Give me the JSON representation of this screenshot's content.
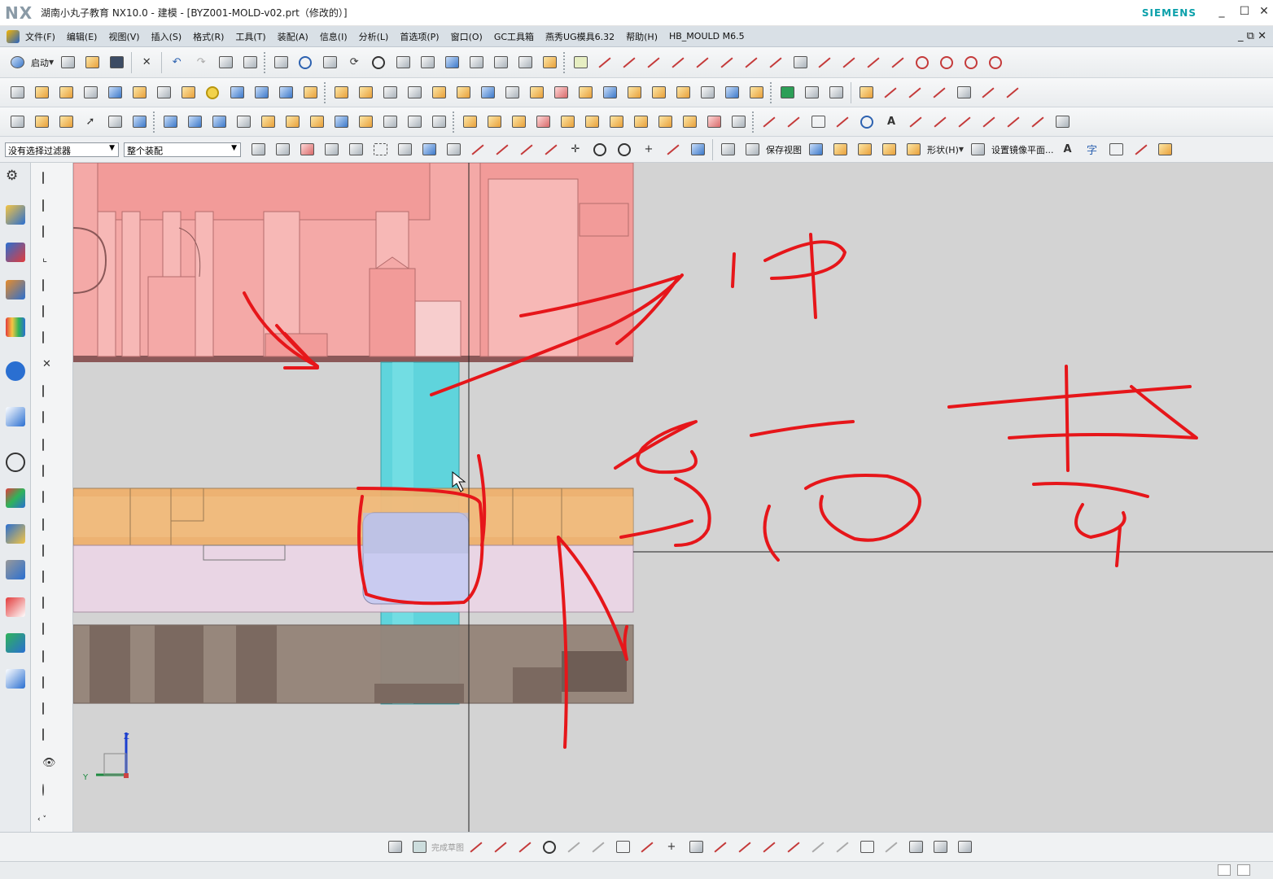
{
  "titlebar": {
    "logo": "NX",
    "title": "湖南小丸子教育 NX10.0 - 建模 - [BYZ001-MOLD-v02.prt（修改的）]",
    "brand": "SIEMENS",
    "minimize": "_",
    "maximize": "☐",
    "close": "✕"
  },
  "menubar": {
    "items": [
      "文件(F)",
      "编辑(E)",
      "视图(V)",
      "插入(S)",
      "格式(R)",
      "工具(T)",
      "装配(A)",
      "信息(I)",
      "分析(L)",
      "首选项(P)",
      "窗口(O)",
      "GC工具箱",
      "燕秀UG模具6.32",
      "帮助(H)",
      "HB_MOULD M6.5"
    ],
    "restore": "_ ⧉ ✕"
  },
  "toolbar1": {
    "start_label": "启动"
  },
  "filterbar": {
    "type_filter": "没有选择过滤器",
    "scope_filter": "整个装配",
    "save_view_label": "保存视图",
    "shape_label": "形状(H)",
    "mirror_plane_label": "设置镜像平面...",
    "text_a": "A",
    "text_zi": "字"
  },
  "bottombar": {
    "sketch_finish_label": "完成草图"
  },
  "triad": {
    "z_label": "Z",
    "y_label": "Y"
  },
  "colors": {
    "plate_pink": "#f4a9a7",
    "plate_orange": "#f0b06a",
    "plate_lavender": "#ecd6e6",
    "plate_brown": "#8f7c72",
    "pillar_cyan": "#5fd4dc",
    "annotation_red": "#e6161a",
    "viewport_bg": "#d3d3d3"
  }
}
